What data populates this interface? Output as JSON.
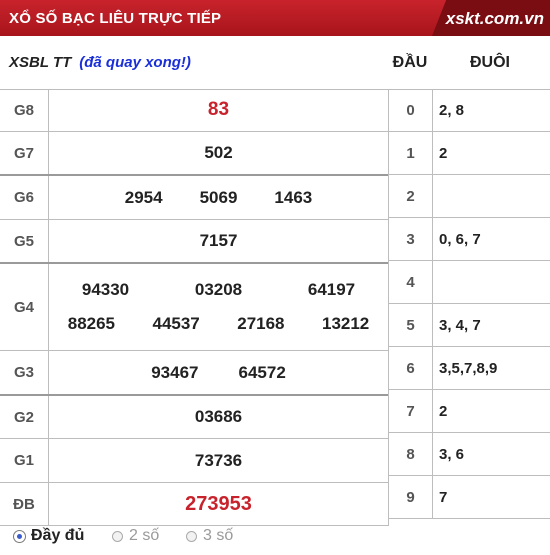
{
  "header": {
    "title": "XỔ SỐ BẠC LIÊU TRỰC TIẾP",
    "logo": "xskt.com.vn"
  },
  "subheader": {
    "code": "XSBL TT",
    "status": "(đã quay xong!)",
    "dau_label": "ĐẦU",
    "duoi_label": "ĐUÔI"
  },
  "prizes": [
    {
      "label": "G8",
      "lines": [
        [
          "83"
        ]
      ]
    },
    {
      "label": "G7",
      "lines": [
        [
          "502"
        ]
      ]
    },
    {
      "label": "G6",
      "lines": [
        [
          "2954",
          "5069",
          "1463"
        ]
      ]
    },
    {
      "label": "G5",
      "lines": [
        [
          "7157"
        ]
      ]
    },
    {
      "label": "G4",
      "lines": [
        [
          "94330",
          "03208",
          "64197"
        ],
        [
          "88265",
          "44537",
          "27168",
          "13212"
        ]
      ]
    },
    {
      "label": "G3",
      "lines": [
        [
          "93467",
          "64572"
        ]
      ]
    },
    {
      "label": "G2",
      "lines": [
        [
          "03686"
        ]
      ]
    },
    {
      "label": "G1",
      "lines": [
        [
          "73736"
        ]
      ]
    },
    {
      "label": "ĐB",
      "lines": [
        [
          "273953"
        ]
      ]
    }
  ],
  "loto": [
    {
      "dau": "0",
      "duoi": "2, 8"
    },
    {
      "dau": "1",
      "duoi": "2"
    },
    {
      "dau": "2",
      "duoi": ""
    },
    {
      "dau": "3",
      "duoi": "0, 6, 7"
    },
    {
      "dau": "4",
      "duoi": ""
    },
    {
      "dau": "5",
      "duoi": "3, 4, 7"
    },
    {
      "dau": "6",
      "duoi": "3,5,7,8,9"
    },
    {
      "dau": "7",
      "duoi": "2"
    },
    {
      "dau": "8",
      "duoi": "3, 6"
    },
    {
      "dau": "9",
      "duoi": "7"
    }
  ],
  "footer": {
    "options": [
      "Đầy đủ",
      "2 số",
      "3 số"
    ],
    "selected": "Đầy đủ"
  },
  "colors": {
    "brand": "#c8232c",
    "status": "#1a2fd8"
  }
}
